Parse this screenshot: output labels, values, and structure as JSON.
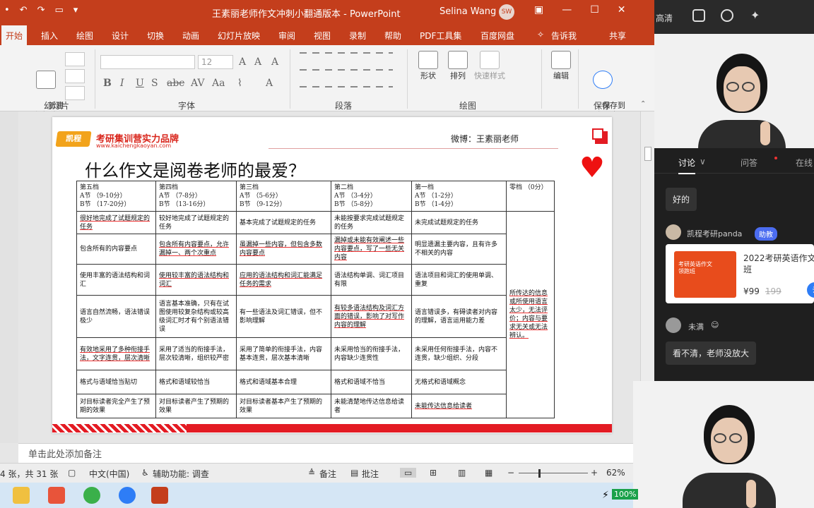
{
  "titlebar": {
    "doc_title": "王素丽老师作文冲刺小翻通版本  -  PowerPoint",
    "user": "Selina Wang",
    "user_initials": "SW"
  },
  "tabs": [
    "开始",
    "插入",
    "绘图",
    "设计",
    "切换",
    "动画",
    "幻灯片放映",
    "审阅",
    "视图",
    "录制",
    "帮助",
    "PDF工具集",
    "百度网盘",
    "告诉我",
    "共享"
  ],
  "ribbon": {
    "new_slide_label": "新建\n幻灯片",
    "font_size": "12",
    "groups": [
      "幻灯片",
      "字体",
      "段落",
      "绘图",
      "保存"
    ],
    "shape_label": "形状",
    "arrange_label": "排列",
    "quickstyle_label": "快速样式",
    "edit_label": "编辑",
    "save_baidu_label": "保存到\n百度网盘"
  },
  "slide": {
    "logo_text": "凯程",
    "brand": "考研集训营实力品牌",
    "brand_url": "www.kaichengkaoyan.com",
    "weibo": "微博：王素丽老师",
    "title": "什么作文是阅卷老师的最爱？",
    "table": {
      "headers": [
        [
          "第五档",
          "A节  （9-10分）",
          "B节  （17-20分）"
        ],
        [
          "第四档",
          "A节  （7-8分）",
          "B节  （13-16分）"
        ],
        [
          "第三档",
          "A节  （5-6分）",
          "B节  （9-12分）"
        ],
        [
          "第二档",
          "A节  （3-4分）",
          "B节  （5-8分）"
        ],
        [
          "第一档",
          "A节  （1-2分）",
          "B节  （1-4分）"
        ],
        [
          "零档  （0分）"
        ]
      ],
      "rows": [
        [
          "很好地完成了试题规定的任务",
          "较好地完成了试题规定的任务",
          "基本完成了试题规定的任务",
          "未能按要求完成试题规定的任务",
          "未完成试题规定的任务"
        ],
        [
          "包含所有的内容要点",
          "包含所有内容要点，允许漏掉一、两个次重点",
          "虽漏掉一些内容，但包含多数内容要点",
          "漏掉或未能有效阐述一些内容要点，写了一些无关内容",
          "明显遗漏主要内容，且有许多不相关的内容"
        ],
        [
          "使用丰富的语法结构和词汇",
          "使用较丰富的语法结构和词汇",
          "应用的语法结构和词汇能满足任务的需求",
          "语法结构单调、词汇项目有限",
          "语法项目和词汇的使用单调、重复"
        ],
        [
          "语言自然流畅，语法错误极少",
          "语言基本准确，只有在试图使用较复杂结构或较高级词汇时才有个别语法错误",
          "有一些语法及词汇错误，但不影响理解",
          "有较多语法结构及词汇方面的错误，影响了对写作内容的理解",
          "语言错误多，有碍读者对内容的理解，语言运用能力差"
        ],
        [
          "有效地采用了多种衔接手法，文字连贯，层次清晰",
          "采用了适当的衔接手法，层次较清晰，组织较严密",
          "采用了简单的衔接手法，内容基本连贯，层次基本清晰",
          "未采用恰当的衔接手法，内容缺少连贯性",
          "未采用任何衔接手法，内容不连贯，缺少组织、分段"
        ],
        [
          "格式与语域恰当贴切",
          "格式和语域较恰当",
          "格式和语域基本合理",
          "格式和语域不恰当",
          "无格式和语域概念"
        ],
        [
          "对目标读者完全产生了预期的效果",
          "对目标读者产生了预期的效果",
          "对目标读者基本产生了预期的效果",
          "未能清楚地传达信息给读者",
          "未能传达信息给读者"
        ]
      ],
      "zero_desc": "所传达的信息或所使用语言太少，无法评价；内容与要求无关或无法辨认。"
    }
  },
  "notes_placeholder": "单击此处添加备注",
  "status": {
    "slide_info": "4 张，共 31 张",
    "language": "中文(中国)",
    "accessibility": "辅助功能: 调查",
    "notes_btn": "备注",
    "comments_btn": "批注",
    "zoom": "62%"
  },
  "live": {
    "quality": "高清",
    "tabs": [
      "讨论",
      "问答",
      "在线"
    ],
    "messages": [
      {
        "name": "",
        "text": "好的"
      },
      {
        "name": "凯程考研panda",
        "badge": "助教"
      },
      {
        "name": "未满",
        "text": "看不清，老师没放大"
      }
    ],
    "course": {
      "thumb_text": "考研英语作文\n领跑班",
      "title": "2022考研英语作文\n班",
      "price": "¥99",
      "old_price": "199",
      "go": "去"
    }
  },
  "taskbar": {
    "battery": "100%"
  }
}
